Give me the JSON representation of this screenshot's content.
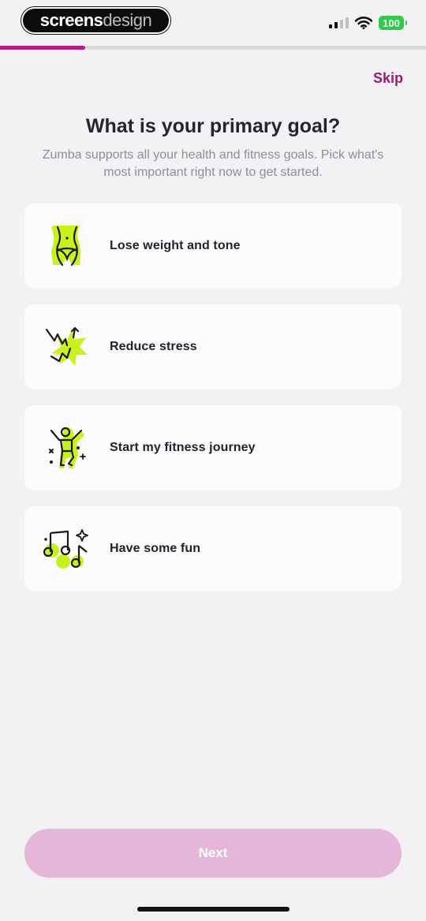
{
  "status_bar": {
    "brand_part1": "screens",
    "brand_part2": "design",
    "battery": "100",
    "icons": [
      "signal-icon",
      "wifi-icon",
      "battery-icon"
    ]
  },
  "progress": {
    "fraction": 0.2
  },
  "header": {
    "skip_label": "Skip"
  },
  "main": {
    "title": "What is your primary goal?",
    "subtitle": "Zumba supports all your health and fitness goals. Pick what's most important right now to get started.",
    "options": [
      {
        "label": "Lose weight and tone",
        "icon": "waist-icon"
      },
      {
        "label": "Reduce stress",
        "icon": "stress-burst-icon"
      },
      {
        "label": "Start my fitness journey",
        "icon": "dancer-icon"
      },
      {
        "label": "Have some fun",
        "icon": "music-notes-icon"
      }
    ]
  },
  "footer": {
    "next_label": "Next"
  },
  "colors": {
    "accent": "#9a1c72",
    "progress": "#b51f84",
    "icon_highlight": "#c8f21d",
    "next_disabled": "#e5b6d7",
    "battery": "#31c94b"
  }
}
